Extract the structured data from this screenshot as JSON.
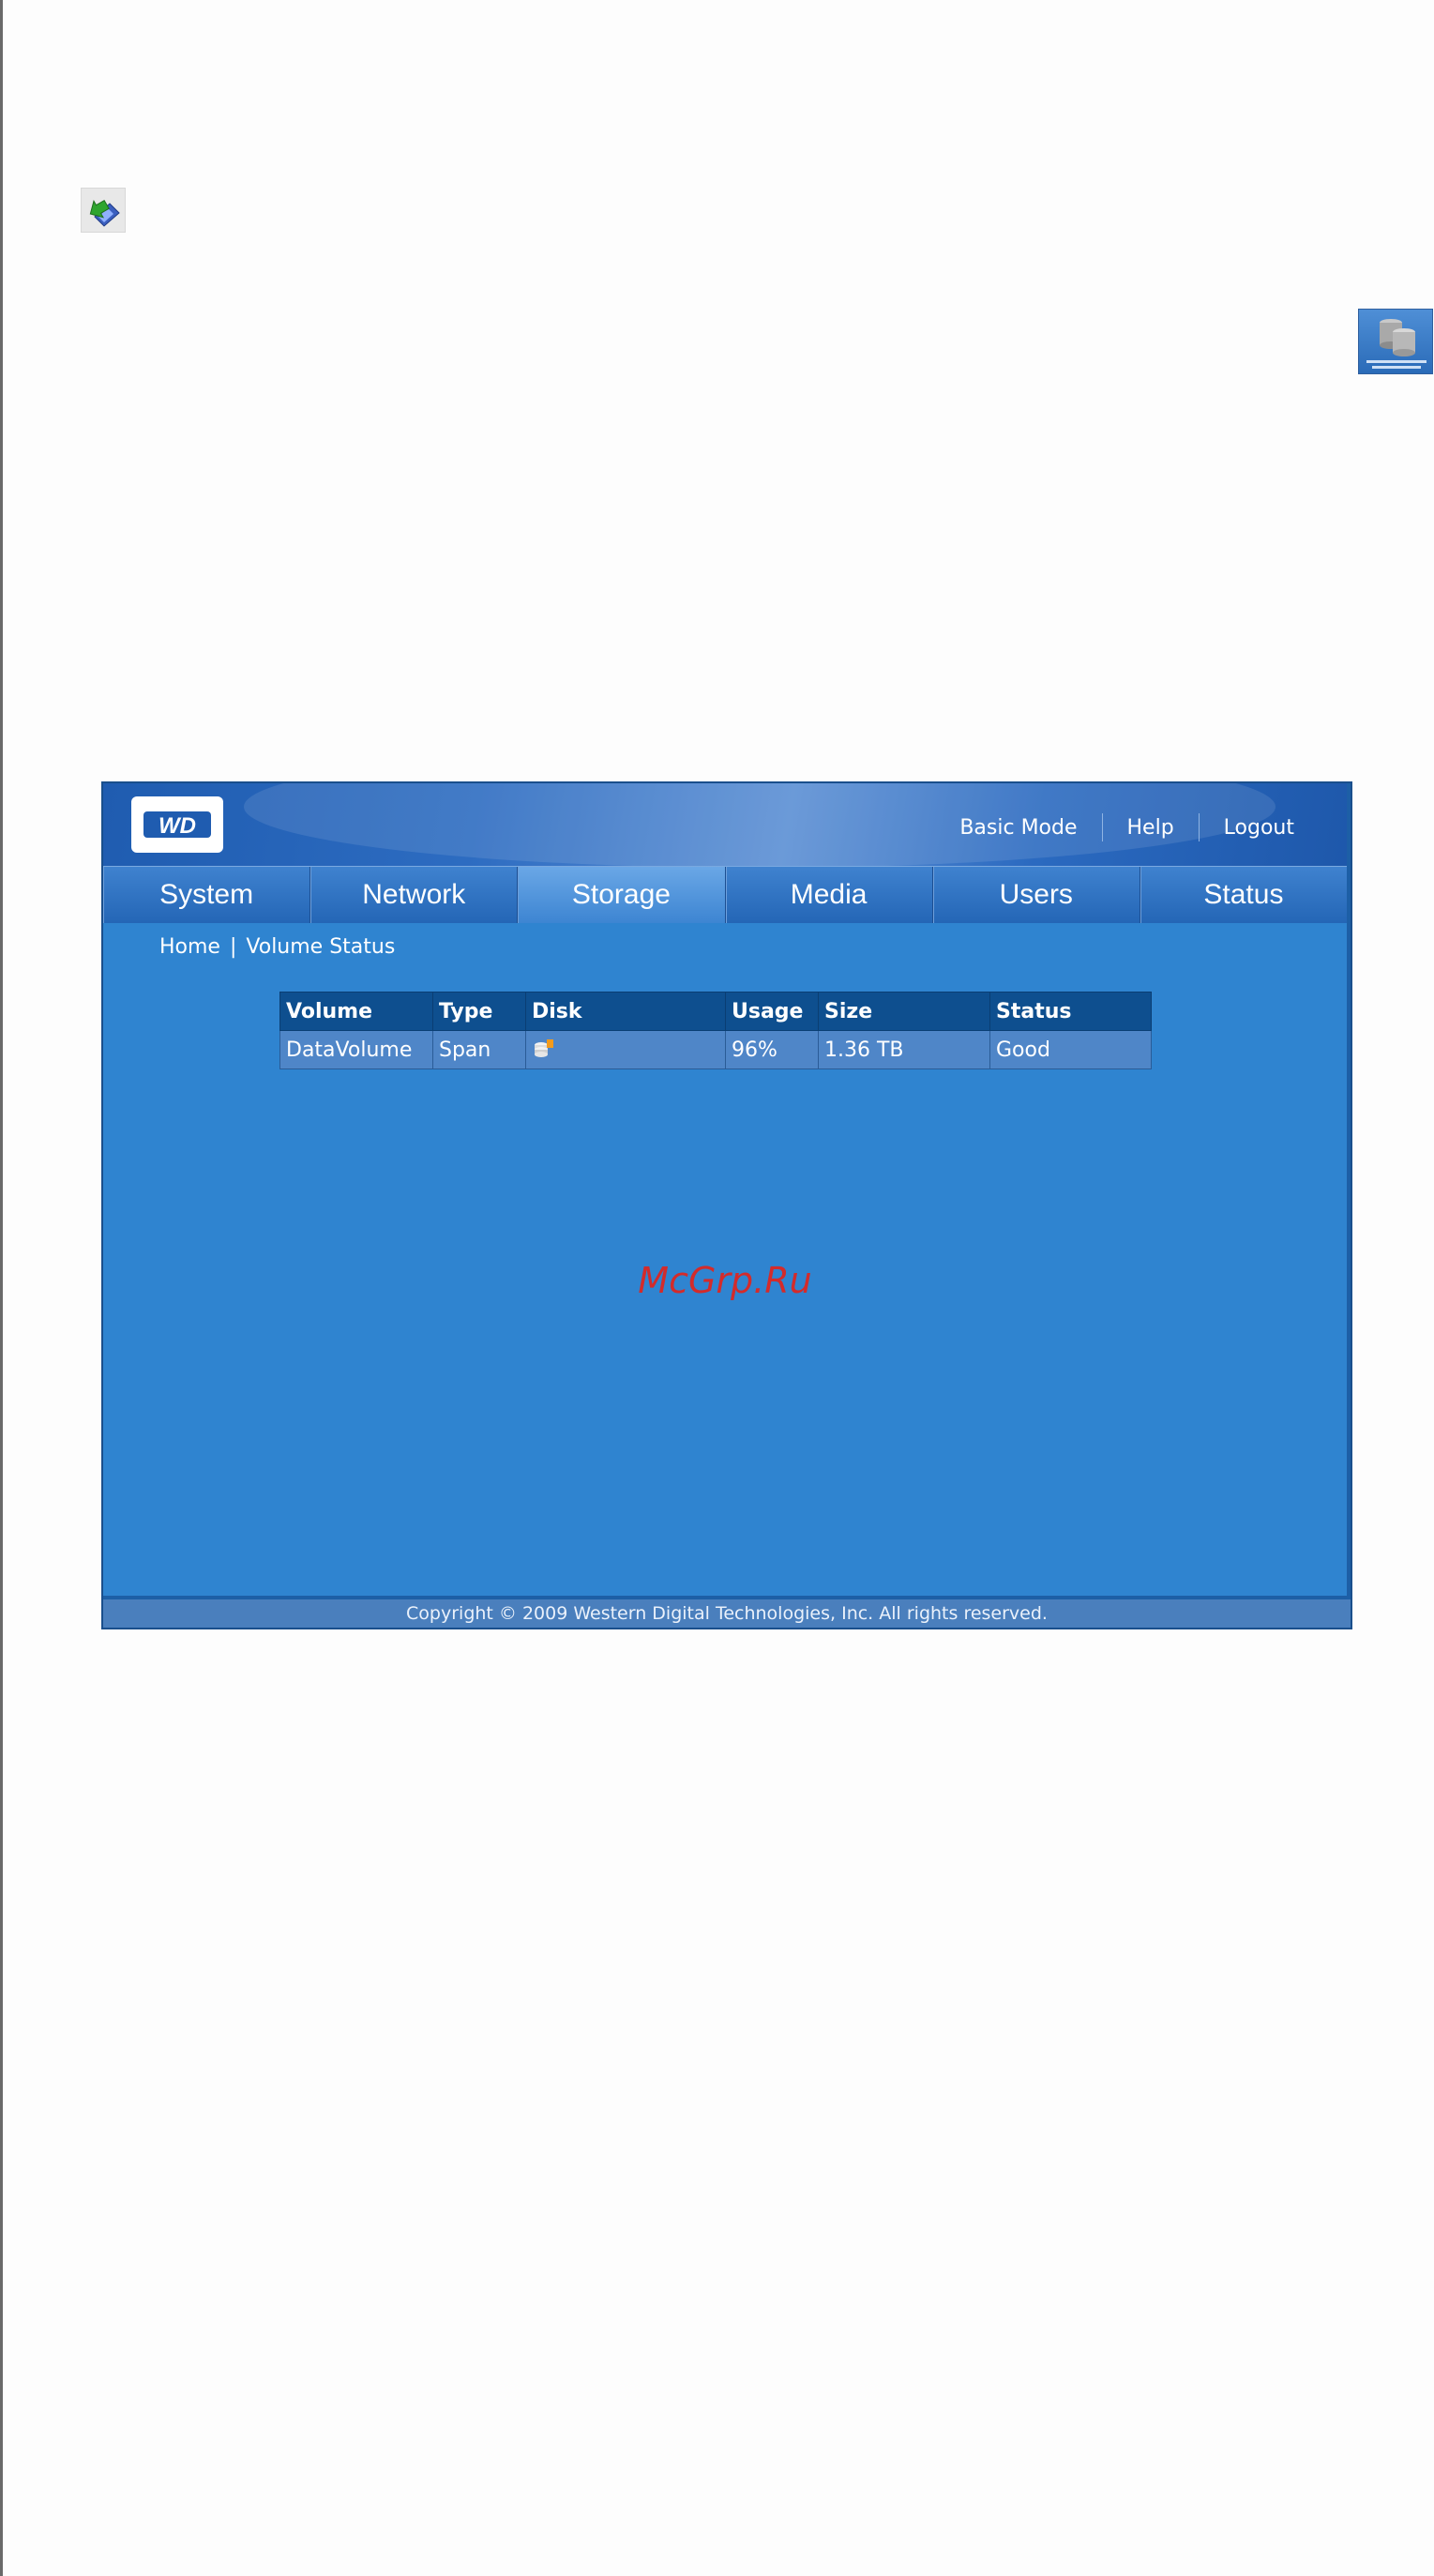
{
  "app": {
    "logo_text": "WD",
    "top_links": [
      "Basic Mode",
      "Help",
      "Logout"
    ],
    "tabs": [
      {
        "label": "System"
      },
      {
        "label": "Network"
      },
      {
        "label": "Storage",
        "active": true
      },
      {
        "label": "Media"
      },
      {
        "label": "Users"
      },
      {
        "label": "Status"
      }
    ],
    "breadcrumb": {
      "home": "Home",
      "separator": "|",
      "current": "Volume Status"
    },
    "table": {
      "headers": [
        "Volume",
        "Type",
        "Disk",
        "Usage",
        "Size",
        "Status"
      ],
      "rows": [
        {
          "volume": "DataVolume",
          "type": "Span",
          "disk_icon": "disk-stack-icon",
          "usage": "96%",
          "size": "1.36 TB",
          "status": "Good"
        }
      ]
    },
    "watermark": "McGrp.Ru",
    "footer": "Copyright © 2009 Western Digital Technologies, Inc. All rights reserved."
  },
  "icons": {
    "document_icon": "diskette-arrow-icon",
    "volume_raid_icon": "volume-raid-management-icon"
  },
  "colors": {
    "app_bg": "#2f84d0",
    "header_dark": "#1f5cb0",
    "table_header": "#0e4f8f",
    "table_row": "#4f86c8",
    "watermark": "#d32b2b"
  }
}
